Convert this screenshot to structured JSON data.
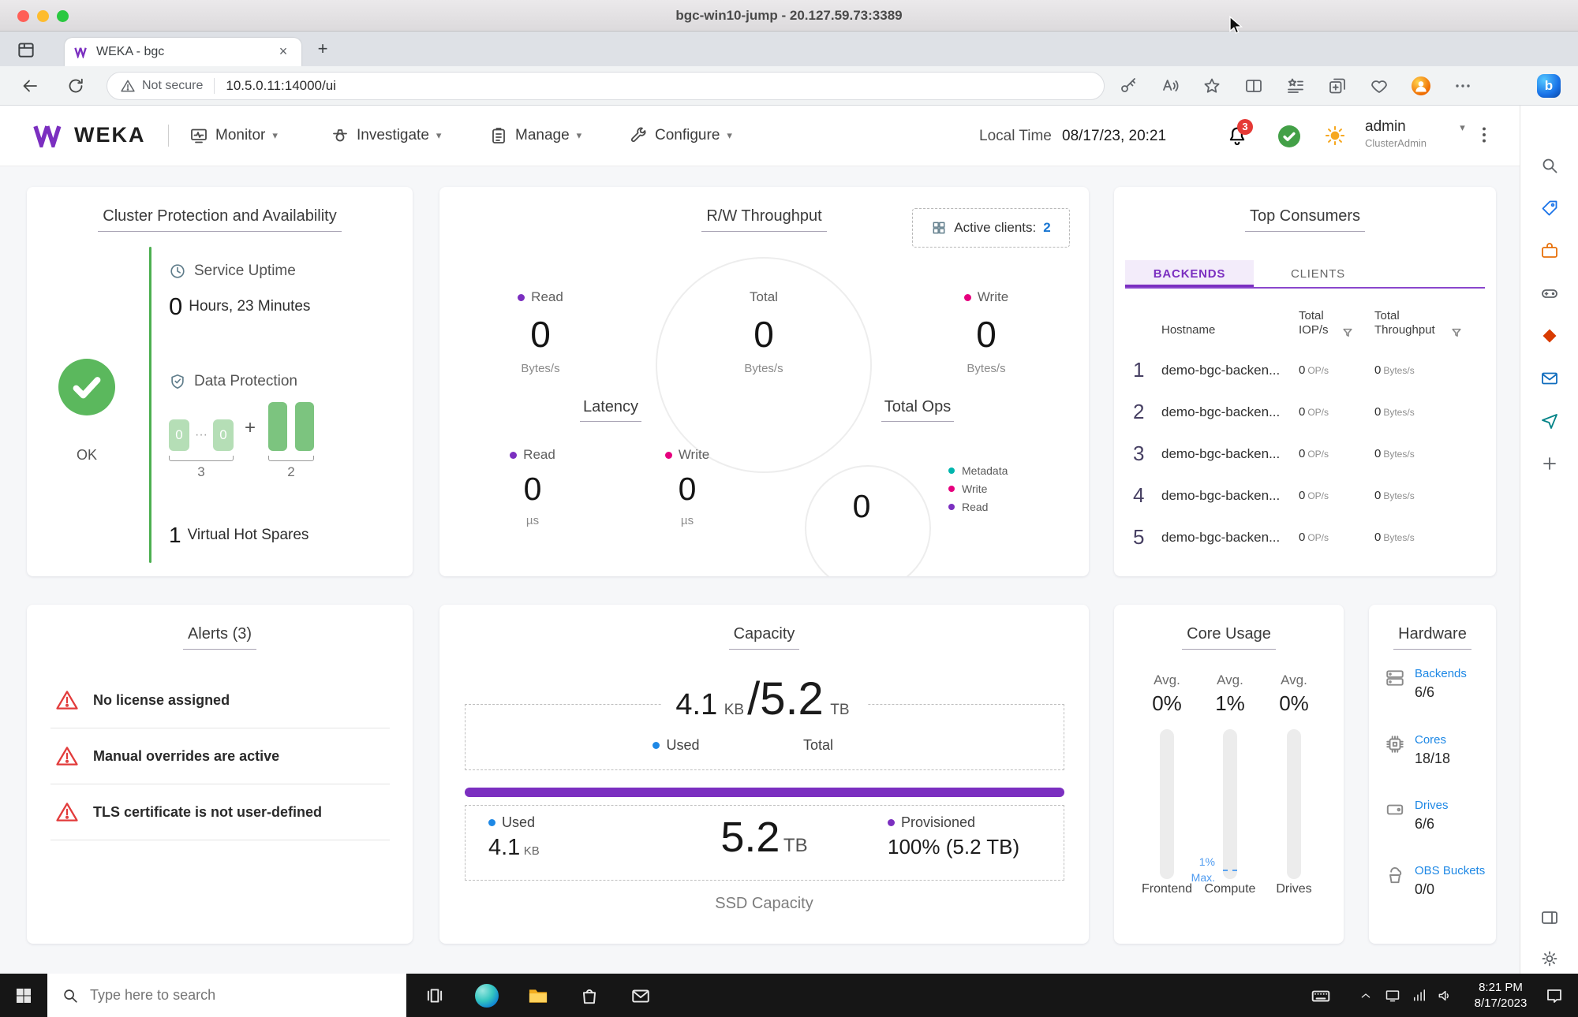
{
  "colors": {
    "accent_purple": "#7b2fc0",
    "magenta": "#e6007e",
    "teal": "#00b5ad",
    "blue": "#1e88e5",
    "green": "#4caf50",
    "alert_red": "#e23b3b"
  },
  "window": {
    "title": "bgc-win10-jump - 20.127.59.73:3389"
  },
  "browser": {
    "tab_title": "WEKA - bgc",
    "tab_close_glyph": "×",
    "new_tab_glyph": "+",
    "security_label": "Not secure",
    "url": "10.5.0.11:14000/ui",
    "copilot_glyph": "b",
    "toolbar_icons": [
      "password-key",
      "read-aloud",
      "favorite-star",
      "split-screen",
      "favorites-bar",
      "collections",
      "browser-essentials",
      "profile",
      "settings-ellipsis",
      "bing-copilot"
    ],
    "sidebar_icons": [
      "search",
      "shopping",
      "tools",
      "games",
      "microsoft-365",
      "outlook",
      "drop",
      "add",
      "sidebar-panel",
      "settings-gear"
    ]
  },
  "header": {
    "brand": "WEKA",
    "nav": [
      {
        "label": "Monitor"
      },
      {
        "label": "Investigate"
      },
      {
        "label": "Manage"
      },
      {
        "label": "Configure"
      }
    ],
    "local_time_label": "Local Time",
    "local_time_value": "08/17/23, 20:21",
    "notification_count": "3",
    "user_name": "admin",
    "user_role": "ClusterAdmin"
  },
  "cluster": {
    "title": "Cluster Protection and Availability",
    "ok_label": "OK",
    "uptime_label": "Service Uptime",
    "uptime_value": "0",
    "uptime_text": "Hours, 23 Minutes",
    "protection_label": "Data Protection",
    "block_left_1": "0",
    "block_dots": "···",
    "block_left_2": "0",
    "left_count": "3",
    "plus": "+",
    "right_count": "2",
    "spares_value": "1",
    "spares_label": "Virtual Hot Spares"
  },
  "throughput": {
    "title": "R/W Throughput",
    "active_clients_label": "Active clients:",
    "active_clients_value": "2",
    "cols": [
      {
        "label": "Read",
        "value": "0",
        "unit": "Bytes/s"
      },
      {
        "label": "Total",
        "value": "0",
        "unit": "Bytes/s"
      },
      {
        "label": "Write",
        "value": "0",
        "unit": "Bytes/s"
      }
    ],
    "latency": {
      "title": "Latency",
      "cols": [
        {
          "label": "Read",
          "value": "0",
          "unit": "µs"
        },
        {
          "label": "Write",
          "value": "0",
          "unit": "µs"
        }
      ]
    },
    "total_ops": {
      "title": "Total Ops",
      "value": "0",
      "legend": [
        {
          "label": "Metadata"
        },
        {
          "label": "Write"
        },
        {
          "label": "Read"
        }
      ]
    }
  },
  "consumers": {
    "title": "Top Consumers",
    "tabs": [
      {
        "label": "BACKENDS"
      },
      {
        "label": "CLIENTS"
      }
    ],
    "col_hostname": "Hostname",
    "col_iops": "Total IOP/s",
    "col_tp": "Total Throughput",
    "rows": [
      {
        "rank": "1",
        "hostname": "demo-bgc-backen...",
        "iops_value": "0",
        "iops_unit": "OP/s",
        "tp_value": "0",
        "tp_unit": "Bytes/s"
      },
      {
        "rank": "2",
        "hostname": "demo-bgc-backen...",
        "iops_value": "0",
        "iops_unit": "OP/s",
        "tp_value": "0",
        "tp_unit": "Bytes/s"
      },
      {
        "rank": "3",
        "hostname": "demo-bgc-backen...",
        "iops_value": "0",
        "iops_unit": "OP/s",
        "tp_value": "0",
        "tp_unit": "Bytes/s"
      },
      {
        "rank": "4",
        "hostname": "demo-bgc-backen...",
        "iops_value": "0",
        "iops_unit": "OP/s",
        "tp_value": "0",
        "tp_unit": "Bytes/s"
      },
      {
        "rank": "5",
        "hostname": "demo-bgc-backen...",
        "iops_value": "0",
        "iops_unit": "OP/s",
        "tp_value": "0",
        "tp_unit": "Bytes/s"
      }
    ]
  },
  "alerts": {
    "title": "Alerts (3)",
    "items": [
      {
        "text": "No license assigned"
      },
      {
        "text": "Manual overrides are active"
      },
      {
        "text": "TLS certificate is not user-defined"
      }
    ]
  },
  "capacity": {
    "title": "Capacity",
    "top": {
      "used_value": "4.1",
      "used_unit": "KB",
      "slash": "/",
      "total_value": "5.2",
      "total_unit": "TB",
      "used_label": "Used",
      "total_label": "Total"
    },
    "bottom": {
      "used_label": "Used",
      "used_value": "4.1",
      "used_unit": "KB",
      "center_value": "5.2",
      "center_unit": "TB",
      "prov_label": "Provisioned",
      "prov_value": "100% (5.2 TB)"
    },
    "footer": "SSD Capacity"
  },
  "core_usage": {
    "title": "Core Usage",
    "columns": [
      {
        "avg": "Avg.",
        "value": "0%",
        "name": "Frontend"
      },
      {
        "avg": "Avg.",
        "value": "1%",
        "name": "Compute"
      },
      {
        "avg": "Avg.",
        "value": "0%",
        "name": "Drives"
      }
    ],
    "max_value": "1%",
    "max_label": "Max."
  },
  "hardware": {
    "title": "Hardware",
    "items": [
      {
        "label": "Backends",
        "value": "6/6"
      },
      {
        "label": "Cores",
        "value": "18/18"
      },
      {
        "label": "Drives",
        "value": "6/6"
      },
      {
        "label": "OBS Buckets",
        "value": "0/0"
      }
    ]
  },
  "taskbar": {
    "search_placeholder": "Type here to search",
    "time": "8:21 PM",
    "date": "8/17/2023"
  }
}
